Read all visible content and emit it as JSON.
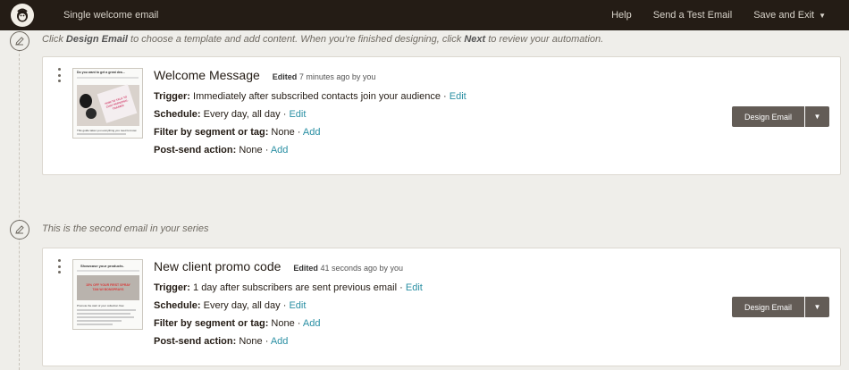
{
  "topbar": {
    "app_title": "Single welcome email",
    "help": "Help",
    "send_test": "Send a Test Email",
    "save_exit": "Save and Exit"
  },
  "step1": {
    "text_a": "Click ",
    "text_b": "Design Email",
    "text_c": " to choose a template and add content. When you're finished designing, click ",
    "text_d": "Next",
    "text_e": " to review your automation."
  },
  "step2": {
    "text": "This is the second email in your series"
  },
  "emails": [
    {
      "title": "Welcome Message",
      "edited_label": "Edited",
      "edited_time": "7 minutes ago by you",
      "trigger_label": "Trigger:",
      "trigger_value": "Immediately after subscribed contacts join your audience",
      "schedule_label": "Schedule:",
      "schedule_value": "Every day, all day",
      "filter_label": "Filter by segment or tag:",
      "filter_value": "None",
      "post_label": "Post-send action:",
      "post_value": "None",
      "edit_link": "Edit",
      "add_link": "Add",
      "sep": " · ",
      "button": "Design Email",
      "thumb": {
        "headline": "Do you want to get a great dea...",
        "promo": "HOW TO TALK TO CHAT PERSONAL TRAINER",
        "footer": "This guide takes you everything you need to know"
      }
    },
    {
      "title": "New client promo code",
      "edited_label": "Edited",
      "edited_time": "41 seconds ago by you",
      "trigger_label": "Trigger:",
      "trigger_value": "1 day after subscribers are sent previous email",
      "schedule_label": "Schedule:",
      "schedule_value": "Every day, all day",
      "filter_label": "Filter by segment or tag:",
      "filter_value": "None",
      "post_label": "Post-send action:",
      "post_value": "None",
      "edit_link": "Edit",
      "add_link": "Add",
      "sep": " · ",
      "button": "Design Email",
      "thumb": {
        "headline": "Showcase your products.",
        "promo": "15% OFF YOUR FIRST SPRAY TAN W/ BONSPRAYS",
        "footer": "Promote the start of your collection flow"
      }
    }
  ],
  "colors": {
    "topbar": "#241c15",
    "background": "#efeeea",
    "link": "#2a8fa3",
    "button": "#635c56"
  },
  "icons": {
    "logo": "mailchimp-logo-icon",
    "step": "pencil-icon",
    "dropdown": "chevron-down-icon",
    "menu": "kebab-menu-icon"
  }
}
